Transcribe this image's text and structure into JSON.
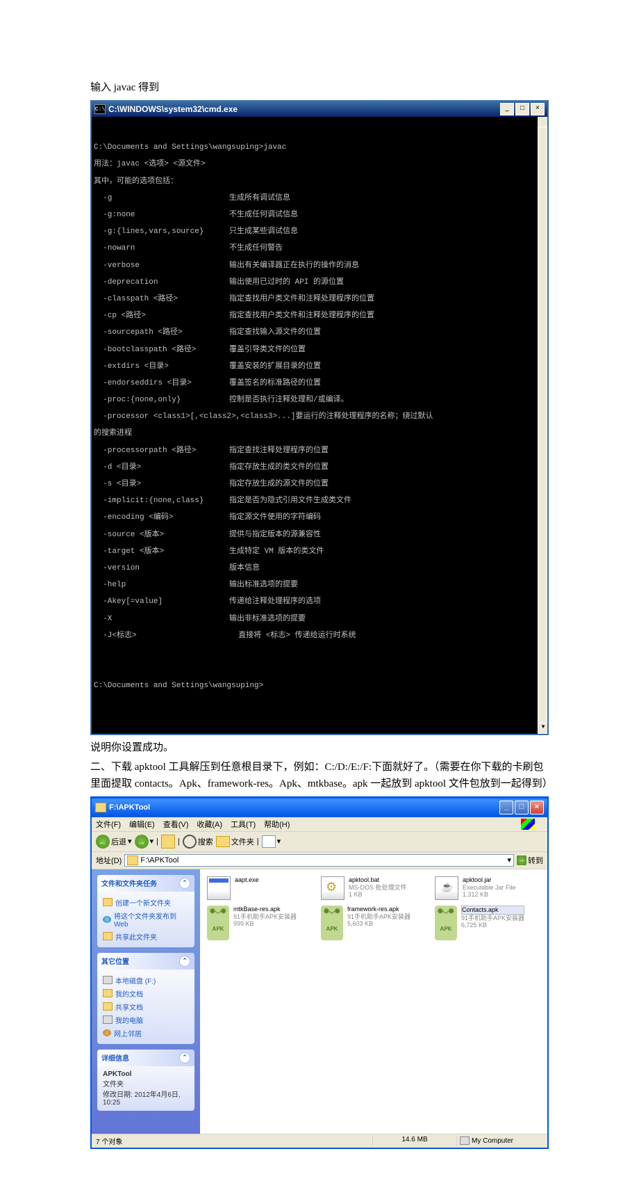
{
  "doc": {
    "line1": "输入 javac 得到",
    "line2": "说明你设置成功。",
    "line3": "二、下载 apktool 工具解压到任意根目录下，例如：C:/D:/E:/F:下面就好了。（需要在你下载的卡刷包里面提取 contacts。Apk、framework-res。Apk、mtkbase。apk 一起放到 apktool 文件包放到一起得到）"
  },
  "cmd": {
    "title": "C:\\WINDOWS\\system32\\cmd.exe",
    "prompt1": "C:\\Documents and Settings\\wangsuping>javac",
    "usage": "用法：javac <选项> <源文件>",
    "possible": "其中，可能的选项包括：",
    "options": [
      {
        "flag": "  -g",
        "desc": "生成所有调试信息"
      },
      {
        "flag": "  -g:none",
        "desc": "不生成任何调试信息"
      },
      {
        "flag": "  -g:{lines,vars,source}",
        "desc": "只生成某些调试信息"
      },
      {
        "flag": "  -nowarn",
        "desc": "不生成任何警告"
      },
      {
        "flag": "  -verbose",
        "desc": "输出有关编译器正在执行的操作的消息"
      },
      {
        "flag": "  -deprecation",
        "desc": "输出使用已过时的 API 的源位置"
      },
      {
        "flag": "  -classpath <路径>",
        "desc": "指定查找用户类文件和注释处理程序的位置"
      },
      {
        "flag": "  -cp <路径>",
        "desc": "指定查找用户类文件和注释处理程序的位置"
      },
      {
        "flag": "  -sourcepath <路径>",
        "desc": "指定查找输入源文件的位置"
      },
      {
        "flag": "  -bootclasspath <路径>",
        "desc": "覆盖引导类文件的位置"
      },
      {
        "flag": "  -extdirs <目录>",
        "desc": "覆盖安装的扩展目录的位置"
      },
      {
        "flag": "  -endorseddirs <目录>",
        "desc": "覆盖签名的标准路径的位置"
      },
      {
        "flag": "  -proc:{none,only}",
        "desc": "控制是否执行注释处理和/或编译。"
      },
      {
        "flag": "  -processor <class1>[,<class2>,<class3>...]要运行的注释处理程序的名称；绕过默认",
        "desc": ""
      }
    ],
    "search_proc": "的搜索进程",
    "options2": [
      {
        "flag": "  -processorpath <路径>",
        "desc": "指定查找注释处理程序的位置"
      },
      {
        "flag": "  -d <目录>",
        "desc": "指定存放生成的类文件的位置"
      },
      {
        "flag": "  -s <目录>",
        "desc": "指定存放生成的源文件的位置"
      },
      {
        "flag": "  -implicit:{none,class}",
        "desc": "指定是否为隐式引用文件生成类文件"
      },
      {
        "flag": "  -encoding <编码>",
        "desc": "指定源文件使用的字符编码"
      },
      {
        "flag": "  -source <版本>",
        "desc": "提供与指定版本的源兼容性"
      },
      {
        "flag": "  -target <版本>",
        "desc": "生成特定 VM 版本的类文件"
      },
      {
        "flag": "  -version",
        "desc": "版本信息"
      },
      {
        "flag": "  -help",
        "desc": "输出标准选项的提要"
      },
      {
        "flag": "  -Akey[=value]",
        "desc": "传递给注释处理程序的选项"
      },
      {
        "flag": "  -X",
        "desc": "输出非标准选项的提要"
      },
      {
        "flag": "  -J<标志>",
        "desc": "  直接将 <标志> 传递给运行时系统"
      }
    ],
    "prompt2": "C:\\Documents and Settings\\wangsuping>"
  },
  "explorer": {
    "title": "F:\\APKTool",
    "menu": {
      "file": "文件(F)",
      "edit": "编辑(E)",
      "view": "查看(V)",
      "fav": "收藏(A)",
      "tools": "工具(T)",
      "help": "帮助(H)"
    },
    "toolbar": {
      "back": "后退",
      "search": "搜索",
      "folders": "文件夹"
    },
    "address_label": "地址(D)",
    "address_value": "F:\\APKTool",
    "go": "转到",
    "panels": {
      "tasks_title": "文件和文件夹任务",
      "tasks": [
        "创建一个新文件夹",
        "将这个文件夹发布到 Web",
        "共享此文件夹"
      ],
      "other_title": "其它位置",
      "other": [
        "本地磁盘 (F:)",
        "我的文档",
        "共享文档",
        "我的电脑",
        "网上邻居"
      ],
      "details_title": "详细信息",
      "details_name": "APKTool",
      "details_type": "文件夹",
      "details_date": "修改日期: 2012年4月6日, 10:25"
    },
    "files": [
      {
        "name": "aapt.exe",
        "meta1": "",
        "meta2": "",
        "type": "exe"
      },
      {
        "name": "apktool.bat",
        "meta1": "MS-DOS 批处理文件",
        "meta2": "1 KB",
        "type": "bat"
      },
      {
        "name": "apktool.jar",
        "meta1": "Executable Jar File",
        "meta2": "1,312 KB",
        "type": "jar"
      },
      {
        "name": "mtkBase-res.apk",
        "meta1": "91手机助手APK安装器",
        "meta2": "999 KB",
        "type": "apk"
      },
      {
        "name": "framework-res.apk",
        "meta1": "91手机助手APK安装器",
        "meta2": "5,603 KB",
        "type": "apk"
      },
      {
        "name": "Contacts.apk",
        "meta1": "91手机助手APK安装器",
        "meta2": "6,725 KB",
        "type": "apk",
        "selected": true
      }
    ],
    "status": {
      "left": "7 个对象",
      "mid": "14.6 MB",
      "right": "My Computer"
    }
  }
}
